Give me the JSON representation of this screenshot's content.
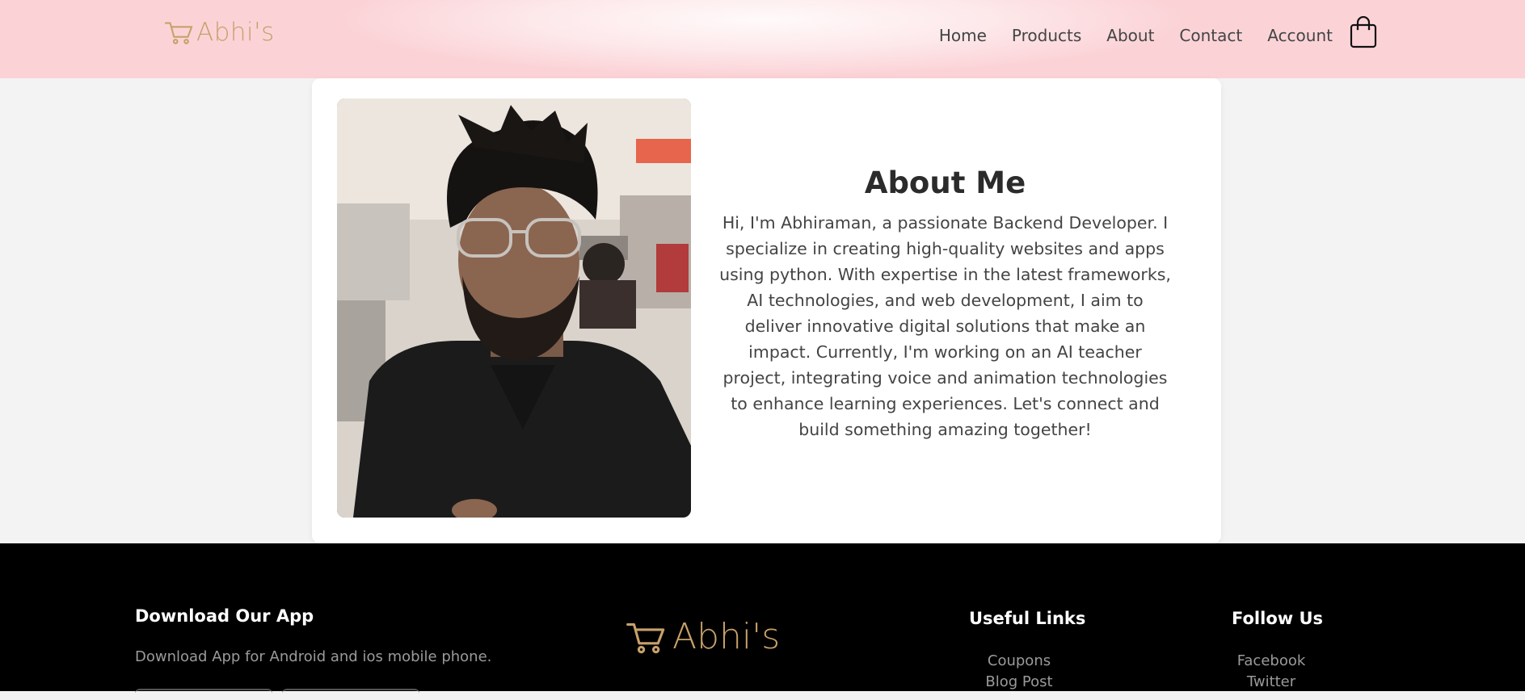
{
  "header": {
    "logo_text": "Abhi's",
    "logo_icon": "cart-icon",
    "nav": [
      {
        "label": "Home"
      },
      {
        "label": "Products"
      },
      {
        "label": "About"
      },
      {
        "label": "Contact"
      },
      {
        "label": "Account"
      }
    ],
    "cart_icon": "shopping-bag-icon"
  },
  "about": {
    "title": "About Me",
    "body": "Hi, I'm Abhiraman, a passionate Backend Developer. I specialize in creating high-quality websites and apps using python. With expertise in the latest frameworks, AI technologies, and web development, I aim to deliver innovative digital solutions that make an impact. Currently, I'm working on an AI teacher project, integrating voice and animation technologies to enhance learning experiences. Let's connect and build something amazing together!"
  },
  "footer": {
    "app_title": "Download Our App",
    "app_desc": "Download App for Android and ios mobile phone.",
    "logo_text": "Abhi's",
    "links_title": "Useful Links",
    "links": [
      "Coupons",
      "Blog Post"
    ],
    "follow_title": "Follow Us",
    "follow": [
      "Facebook",
      "Twitter"
    ]
  },
  "colors": {
    "accent_gold": "#c7a16a",
    "header_pink": "#fbd3d7",
    "footer_bg": "#000000"
  }
}
